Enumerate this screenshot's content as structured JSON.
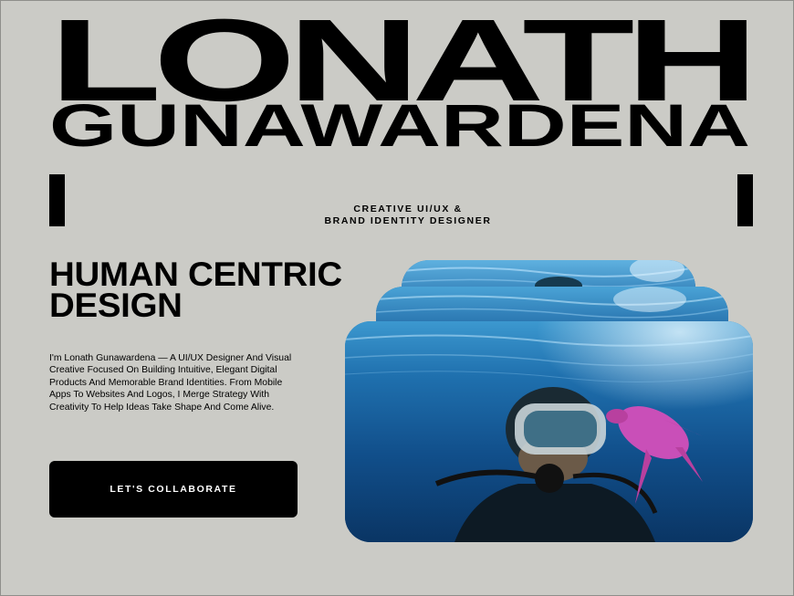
{
  "hero": {
    "first_name": "LONATH",
    "last_name": "GUNAWARDENA"
  },
  "tagline": {
    "line1": "CREATIVE UI/UX &",
    "line2": "BRAND IDENTITY DESIGNER"
  },
  "headline": {
    "line1": "HUMAN CENTRIC",
    "line2": "DESIGN"
  },
  "bio": "I'm Lonath Gunawardena — A UI/UX Designer And Visual Creative Focused On Building Intuitive, Elegant Digital Products And Memorable Brand Identities. From Mobile Apps To Websites And Logos, I Merge Strategy With Creativity To Help Ideas Take Shape And Come Alive.",
  "cta": {
    "label": "LET'S COLLABORATE"
  },
  "colors": {
    "background": "#cbcbc6",
    "ink": "#000000",
    "button_text": "#ffffff",
    "water": "#1d6aa8",
    "turtle": "#c94fb8"
  },
  "icons": {
    "bar_left": "vertical-bar-decoration",
    "bar_right": "vertical-bar-decoration"
  }
}
